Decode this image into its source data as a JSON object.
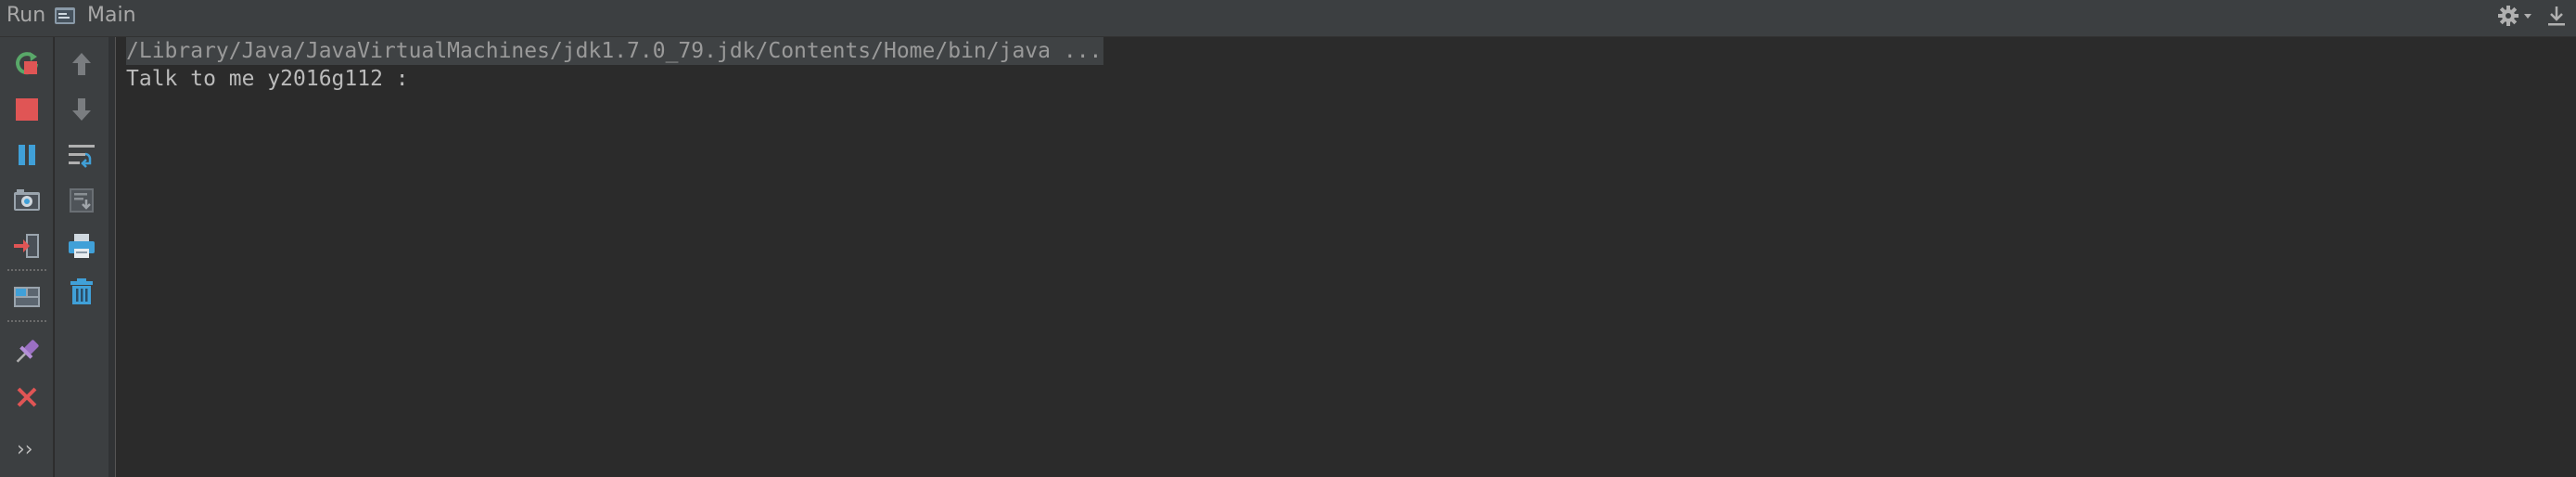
{
  "titlebar": {
    "run_label": "Run",
    "config_name": "Main"
  },
  "left_toolbar": {
    "items": [
      {
        "name": "rerun-icon"
      },
      {
        "name": "stop-icon"
      },
      {
        "name": "pause-icon"
      },
      {
        "name": "dump-threads-icon"
      },
      {
        "name": "exit-icon"
      },
      {
        "name": "restore-layout-icon"
      },
      {
        "name": "pin-icon"
      },
      {
        "name": "close-icon"
      }
    ],
    "more": "››"
  },
  "right_toolbar": {
    "items": [
      {
        "name": "up-arrow-icon"
      },
      {
        "name": "down-arrow-icon"
      },
      {
        "name": "soft-wrap-icon"
      },
      {
        "name": "scroll-to-end-icon"
      },
      {
        "name": "print-icon"
      },
      {
        "name": "clear-all-icon"
      }
    ]
  },
  "console": {
    "command_line": "/Library/Java/JavaVirtualMachines/jdk1.7.0_79.jdk/Contents/Home/bin/java ...",
    "output_line": "Talk to me y2016g112 : "
  },
  "colors": {
    "background": "#2b2b2b",
    "panel": "#3c3f41",
    "text": "#bbbbbb",
    "stop_red": "#e05555",
    "rerun_green": "#59a869",
    "accent_blue": "#40a0d8"
  }
}
